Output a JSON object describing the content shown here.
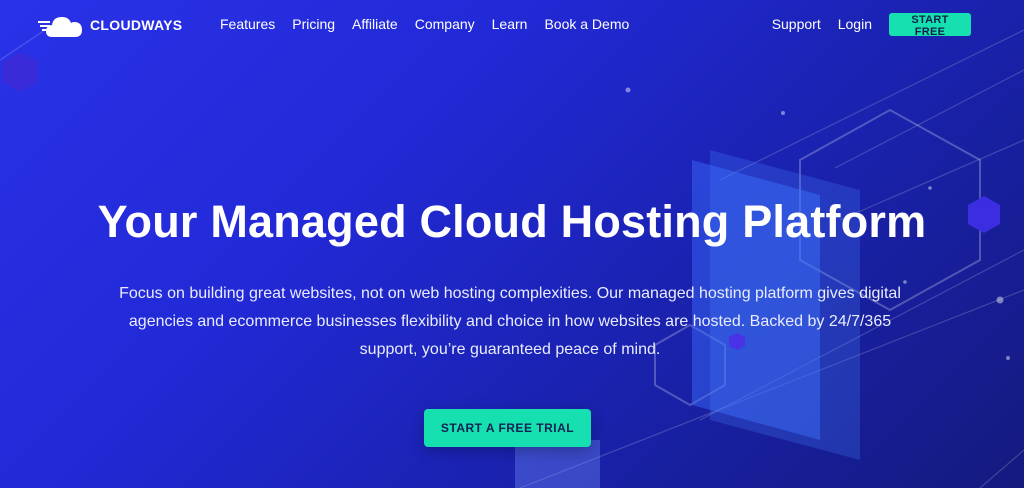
{
  "brand": {
    "name": "CLOUDWAYS",
    "icon": "cloudways-cloud-logo"
  },
  "nav": {
    "items": [
      "Features",
      "Pricing",
      "Affiliate",
      "Company",
      "Learn",
      "Book a Demo"
    ],
    "support": "Support",
    "login": "Login",
    "start_free": "START FREE"
  },
  "hero": {
    "title": "Your Managed Cloud Hosting Platform",
    "subtitle": "Focus on building great websites, not on web hosting complexities. Our managed hosting platform gives digital agencies and ecommerce businesses flexibility and choice in how websites are hosted. Backed by 24/7/365 support, you’re guaranteed peace of mind.",
    "cta": "START A FREE TRIAL"
  },
  "colors": {
    "accent": "#17e0b0",
    "bg_start": "#2a32e8",
    "bg_end": "#141a7e"
  }
}
